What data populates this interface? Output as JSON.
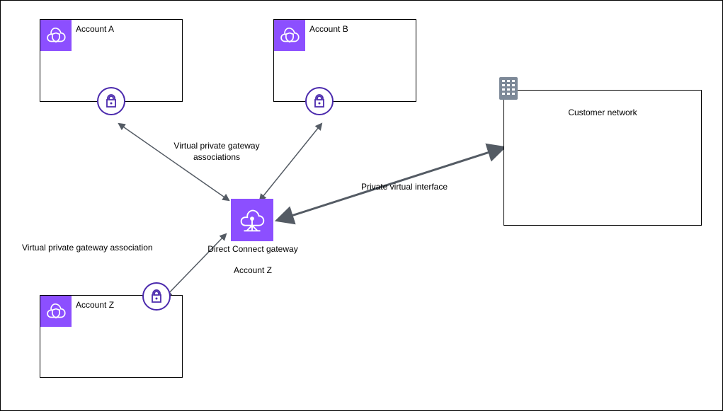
{
  "accounts": {
    "a": {
      "label": "Account A"
    },
    "b": {
      "label": "Account B"
    },
    "z": {
      "label": "Account Z"
    }
  },
  "gateway": {
    "title": "Direct Connect gateway",
    "owner": "Account Z"
  },
  "customer": {
    "label": "Customer network"
  },
  "edges": {
    "vpg_assoc_multi": "Virtual private gateway\nassociations",
    "vpg_assoc_single": "Virtual private gateway association",
    "pvi": "Private virtual interface"
  },
  "icons": {
    "vpc": "vpc-shield",
    "lock": "padlock",
    "gateway": "direct-connect-gateway",
    "building": "office-building"
  },
  "colors": {
    "aws_purple": "#8c4fff",
    "aws_purple_dark": "#4b2aad",
    "arrow": "#545b64",
    "building": "#7d8998"
  }
}
